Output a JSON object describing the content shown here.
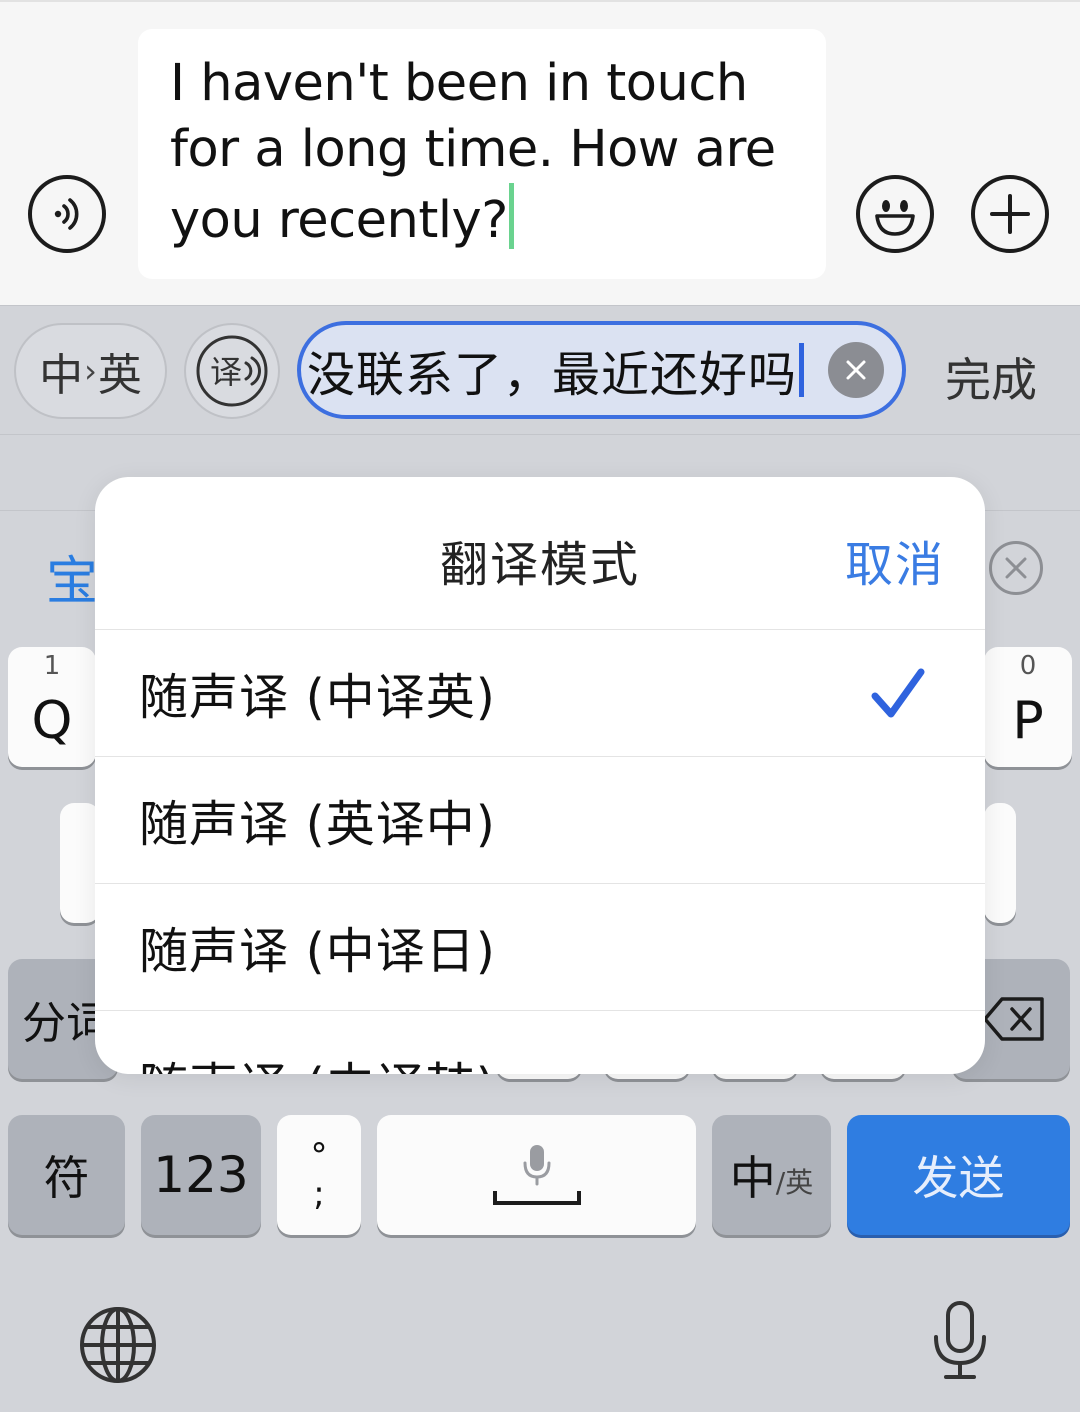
{
  "chat": {
    "message": "I haven't been in touch for a long time. How are you recently?"
  },
  "translate_bar": {
    "lang_from": "中",
    "lang_arrow": "›",
    "lang_to": "英",
    "mode_icon_glyph": "译",
    "input_text": "没联系了，最近还好吗",
    "done_label": "完成"
  },
  "candidates": {
    "first": "宝"
  },
  "keyboard": {
    "q_hint": "1",
    "q": "Q",
    "p_hint": "0",
    "p": "P",
    "fenci": "分词",
    "fu": "符",
    "num": "123",
    "punct_top": "°",
    "punct_bottom": ";",
    "zh": "中",
    "en_small": "/英",
    "send": "发送"
  },
  "modal": {
    "title": "翻译模式",
    "cancel": "取消",
    "options": [
      {
        "label": "随声译 (中译英)",
        "selected": true
      },
      {
        "label": "随声译 (英译中)",
        "selected": false
      },
      {
        "label": "随声译 (中译日)",
        "selected": false
      },
      {
        "label": "随声译 (中译韩)",
        "selected": false
      }
    ]
  },
  "colors": {
    "accent_blue": "#2f7de1",
    "check_blue": "#2f63de",
    "caret_green": "#6ad38f"
  },
  "icons": [
    "voice-message-icon",
    "emoji-icon",
    "plus-icon",
    "translate-mode-icon",
    "clear-icon",
    "close-circle-icon",
    "checkmark-icon",
    "backspace-icon",
    "microphone-icon",
    "globe-icon",
    "dictation-icon"
  ]
}
